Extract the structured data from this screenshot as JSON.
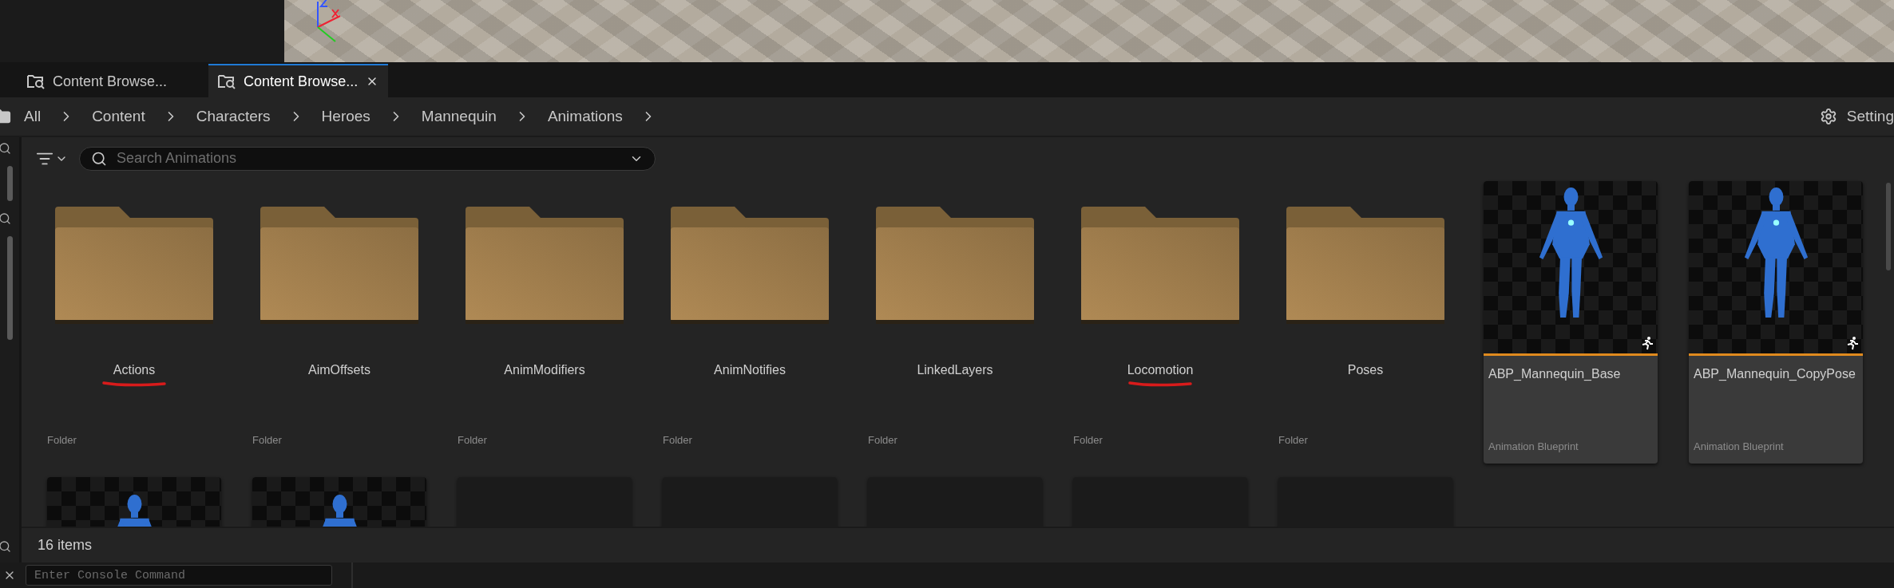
{
  "tabs": [
    {
      "label": "Content Browse...",
      "selected": false
    },
    {
      "label": "Content Browse...",
      "selected": true
    }
  ],
  "breadcrumb": [
    "All",
    "Content",
    "Characters",
    "Heroes",
    "Mannequin",
    "Animations"
  ],
  "settings_button": {
    "label": "Setting"
  },
  "search": {
    "placeholder": "Search Animations"
  },
  "items": [
    {
      "kind": "folder",
      "name": "Actions",
      "type": "Folder",
      "underlined": true
    },
    {
      "kind": "folder",
      "name": "AimOffsets",
      "type": "Folder",
      "underlined": false
    },
    {
      "kind": "folder",
      "name": "AnimModifiers",
      "type": "Folder",
      "underlined": false
    },
    {
      "kind": "folder",
      "name": "AnimNotifies",
      "type": "Folder",
      "underlined": false
    },
    {
      "kind": "folder",
      "name": "LinkedLayers",
      "type": "Folder",
      "underlined": false
    },
    {
      "kind": "folder",
      "name": "Locomotion",
      "type": "Folder",
      "underlined": true
    },
    {
      "kind": "folder",
      "name": "Poses",
      "type": "Folder",
      "underlined": false
    },
    {
      "kind": "blueprint",
      "name": "ABP_Mannequin_Base",
      "type": "Animation Blueprint",
      "underlined": false
    },
    {
      "kind": "blueprint",
      "name": "ABP_Mannequin_CopyPose",
      "type": "Animation Blueprint",
      "underlined": false
    }
  ],
  "more_items": [
    {
      "kind": "thumbnail"
    },
    {
      "kind": "thumbnail"
    },
    {
      "kind": "blank"
    },
    {
      "kind": "blank"
    },
    {
      "kind": "blank"
    },
    {
      "kind": "blank"
    },
    {
      "kind": "blank"
    }
  ],
  "status_bar": {
    "count": "16 items"
  },
  "console": {
    "placeholder": "Enter Console Command"
  }
}
